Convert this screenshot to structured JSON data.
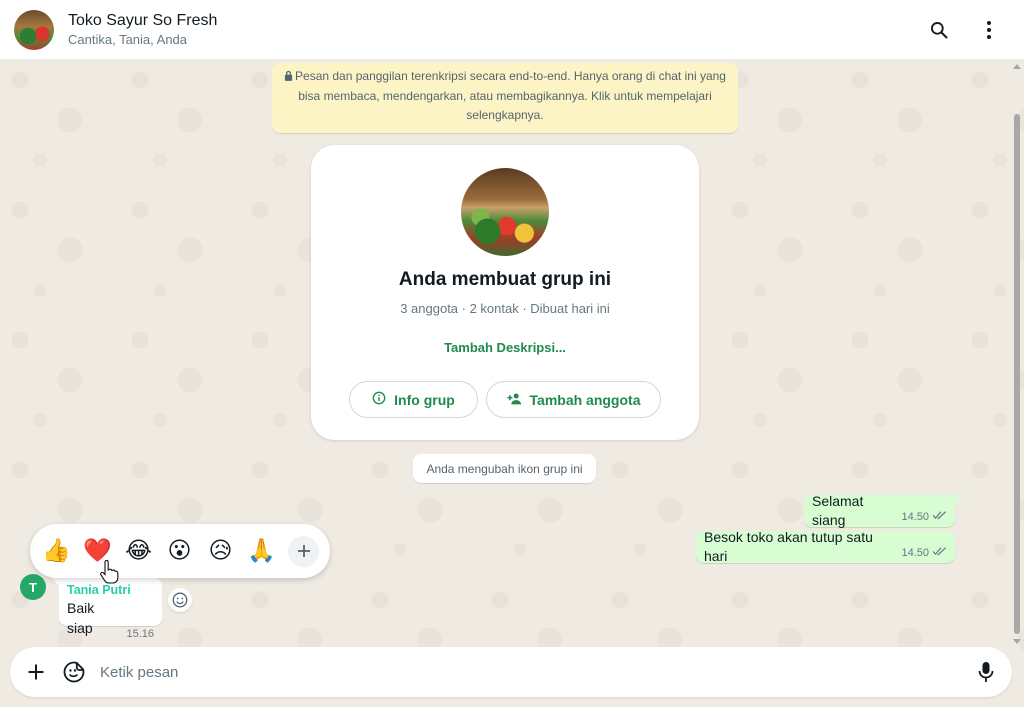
{
  "header": {
    "title": "Toko Sayur So Fresh",
    "subtitle": "Cantika, Tania, Anda"
  },
  "encryption_notice": {
    "text": "Pesan dan panggilan terenkripsi secara end-to-end. Hanya orang di chat ini yang bisa membaca, mendengarkan, atau membagikannya. Klik untuk mempelajari selengkapnya."
  },
  "group_card": {
    "title": "Anda membuat grup ini",
    "subtitle": "3 anggota · 2 kontak · Dibuat hari ini",
    "description_link": "Tambah Deskripsi...",
    "info_button": "Info grup",
    "add_member_button": "Tambah anggota"
  },
  "system_message": "Anda mengubah ikon grup ini",
  "messages_out": [
    {
      "text": "Selamat siang",
      "time": "14.50"
    },
    {
      "text": "Besok toko akan tutup satu hari",
      "time": "14.50"
    }
  ],
  "reactions": [
    "👍",
    "❤️",
    "😂",
    "😮",
    "😥",
    "🙏"
  ],
  "message_in": {
    "sender_initial": "T",
    "sender": "Tania Putri",
    "text": "Baik siap",
    "time": "15.16"
  },
  "composer": {
    "placeholder": "Ketik pesan"
  },
  "colors": {
    "accent": "#1f8a4c",
    "outgoing_bubble": "#d9fdd3",
    "notice_bg": "#fdf4c5",
    "chat_bg": "#efeae2"
  }
}
